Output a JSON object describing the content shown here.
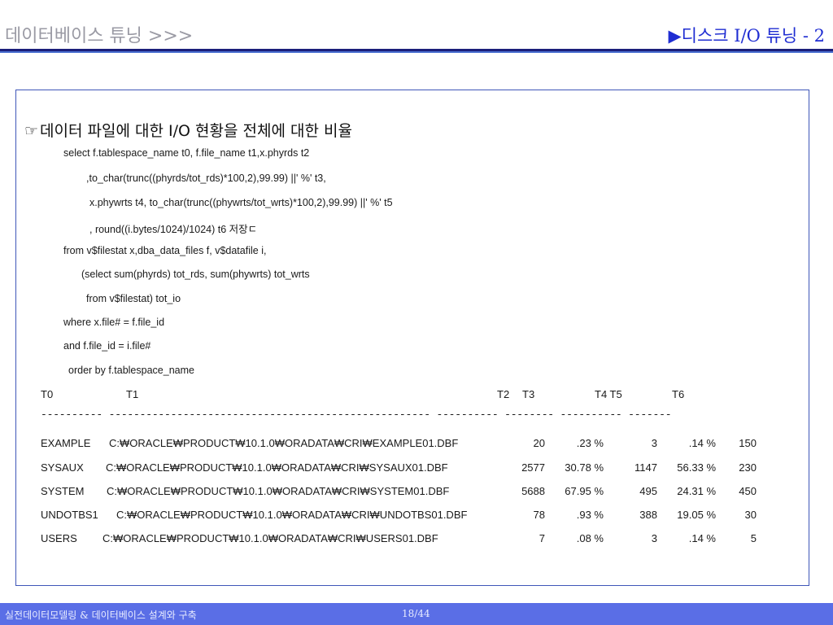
{
  "header": {
    "left_title": "데이터베이스 튜닝 >>>",
    "right_title": "▶디스크 I/O 튜닝 - 2"
  },
  "section": {
    "icon": "pointing-hand-icon",
    "heading": "데이터 파일에 대한 I/O 현황을 전체에 대한 비율"
  },
  "sql_lines": [
    "select f.tablespace_name t0, f.file_name t1,x.phyrds t2",
    ",to_char(trunc((phyrds/tot_rds)*100,2),99.99) ||' %' t3,",
    "x.phywrts t4, to_char(trunc((phywrts/tot_wrts)*100,2),99.99) ||' %' t5",
    ", round((i.bytes/1024)/1024) t6 저장ㄷ",
    "from v$filestat x,dba_data_files f, v$datafile i,",
    "(select sum(phyrds) tot_rds, sum(phywrts) tot_wrts",
    "from v$filestat) tot_io",
    "where x.file# = f.file_id",
    "and f.file_id = i.file#",
    "order by f.tablespace_name"
  ],
  "result": {
    "headers": {
      "t0": "T0",
      "t1": "T1",
      "t2": "T2",
      "t3": "T3",
      "t4t5": "T4 T5",
      "t6": "T6"
    },
    "separator": "---------- ---------------------------------------------------- ---------- -------- ---------- -------",
    "rows": [
      {
        "t0": "EXAMPLE",
        "t1": "C:₩ORACLE₩PRODUCT₩10.1.0₩ORADATA₩CRI₩EXAMPLE01.DBF",
        "t2": "20",
        "t3": ".23 %",
        "t4": "3",
        "t5": ".14 %",
        "t6": "150"
      },
      {
        "t0": "SYSAUX",
        "t1": "C:₩ORACLE₩PRODUCT₩10.1.0₩ORADATA₩CRI₩SYSAUX01.DBF",
        "t2": "2577",
        "t3": "30.78 %",
        "t4": "1147",
        "t5": "56.33 %",
        "t6": "230"
      },
      {
        "t0": "SYSTEM",
        "t1": "C:₩ORACLE₩PRODUCT₩10.1.0₩ORADATA₩CRI₩SYSTEM01.DBF",
        "t2": "5688",
        "t3": "67.95 %",
        "t4": "495",
        "t5": "24.31 %",
        "t6": "450"
      },
      {
        "t0": "UNDOTBS1",
        "t1": "C:₩ORACLE₩PRODUCT₩10.1.0₩ORADATA₩CRI₩UNDOTBS01.DBF",
        "t2": "78",
        "t3": ".93 %",
        "t4": "388",
        "t5": "19.05 %",
        "t6": "30"
      },
      {
        "t0": "USERS",
        "t1": "C:₩ORACLE₩PRODUCT₩10.1.0₩ORADATA₩CRI₩USERS01.DBF",
        "t2": "7",
        "t3": ".08 %",
        "t4": "3",
        "t5": ".14 %",
        "t6": "5"
      }
    ]
  },
  "footer": {
    "left": "실전데이터모델링 & 데이터베이스 설계와 구축",
    "page": "18/44"
  },
  "colors": {
    "header_right": "#1f2dd2",
    "header_left": "#9a9aa4",
    "rule_dark": "#1b1f7a",
    "footer_bar": "#5a6ee6",
    "box_border": "#3f56b8"
  }
}
